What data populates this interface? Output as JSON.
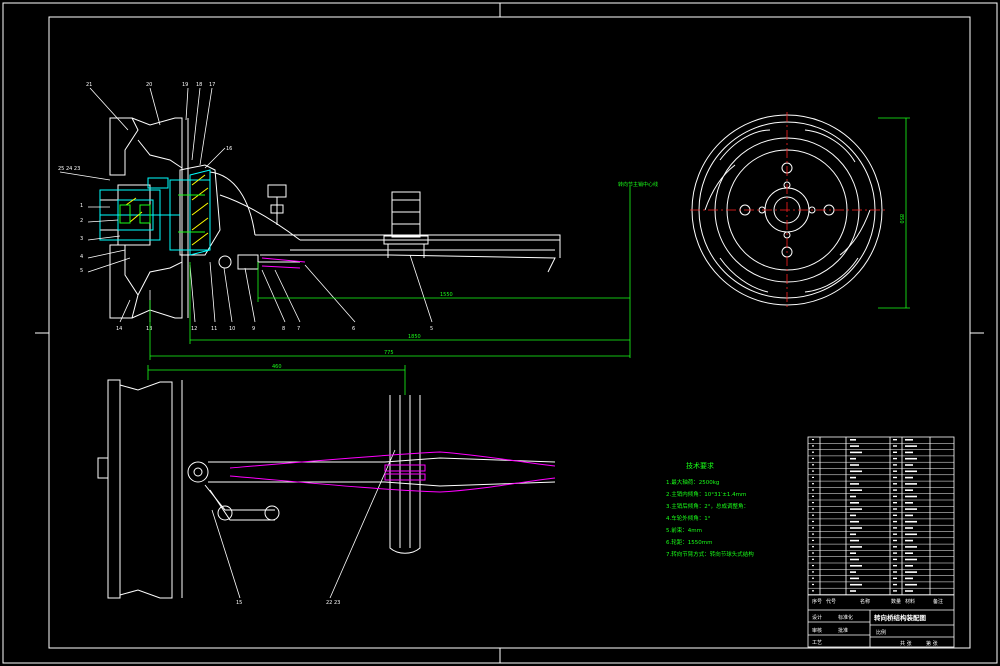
{
  "drawing_title": "转向桥结构装配图",
  "technical_requirements": {
    "heading": "技术要求",
    "items": [
      "1.最大轴荷：2500kg",
      "2.主销内倾角：10°31′±1.4mm",
      "3.主销后倾角：2°，总成调整角：",
      "4.车轮外倾角：1°",
      "5.前束：4mm",
      "6.轮距：1550mm",
      "7.转向节臂方式：转向节球头式结构"
    ]
  },
  "dimension_labels": {
    "steering_center_note": "转向节主销中心线",
    "track_half": "1550",
    "overall": "1850",
    "wheel_offset": "775",
    "wheel_diameter": "850",
    "plan_width": "460"
  },
  "title_block": {
    "row_labels": [
      "序号",
      "代号",
      "名称",
      "数量",
      "材料",
      "备注"
    ],
    "bottom_labels": [
      "设计",
      "审核",
      "工艺",
      "标准化",
      "批准",
      "比例",
      "共 张",
      "第 张"
    ]
  },
  "colors": {
    "background": "#000000",
    "line": "#ffffff",
    "dimension": "#19ff19",
    "center_line": "#ff2020",
    "section": "#00ffff",
    "highlight": "#ff00ff",
    "hatch": "#ffff00"
  }
}
